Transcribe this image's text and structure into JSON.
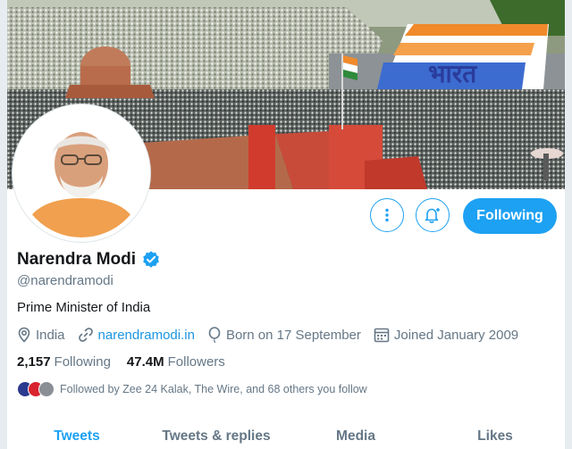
{
  "profile": {
    "name": "Narendra Modi",
    "handle": "@narendramodi",
    "bio": "Prime Minister of India",
    "location": "India",
    "website": "narendramodi.in",
    "birthday": "Born on 17 September",
    "joined": "Joined January 2009"
  },
  "stats": {
    "following_count": "2,157",
    "following_label": "Following",
    "followers_count": "47.4M",
    "followers_label": "Followers"
  },
  "followed_by": "Followed by Zee 24 Kalak, The Wire, and 68 others you follow",
  "buttons": {
    "follow_label": "Following"
  },
  "tabs": [
    {
      "label": "Tweets",
      "active": true
    },
    {
      "label": "Tweets & replies",
      "active": false
    },
    {
      "label": "Media",
      "active": false
    },
    {
      "label": "Likes",
      "active": false
    }
  ],
  "banner": {
    "text": "भारत"
  },
  "colors": {
    "accent": "#1da1f2",
    "link": "#1b95e0",
    "muted": "#657786",
    "text": "#14171a"
  },
  "icons": [
    "more-options-icon",
    "notification-bell-icon",
    "verified-badge-icon",
    "location-pin-icon",
    "link-icon",
    "balloon-icon",
    "calendar-icon"
  ]
}
